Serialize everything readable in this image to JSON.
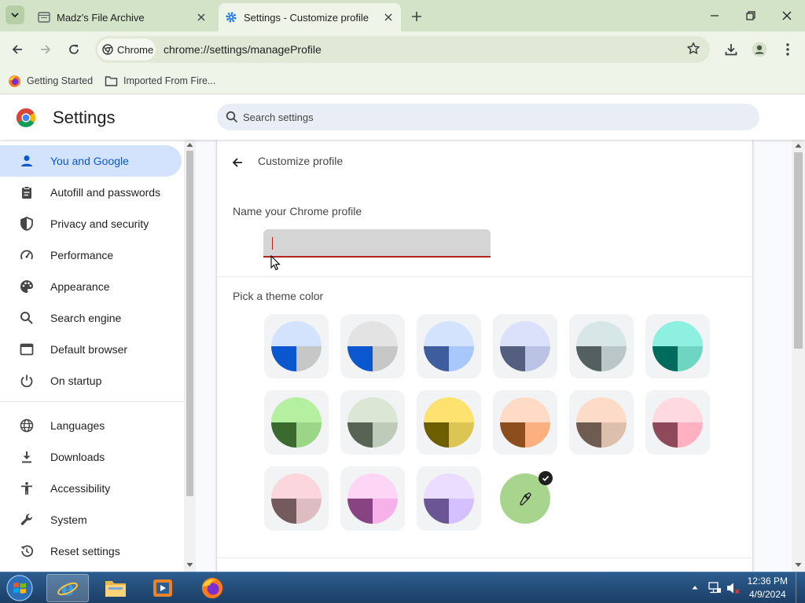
{
  "browser": {
    "tabs": [
      {
        "title": "Madz's File Archive",
        "active": false
      },
      {
        "title": "Settings - Customize profile",
        "active": true
      }
    ],
    "chip_label": "Chrome",
    "url": "chrome://settings/manageProfile",
    "bookmarks": [
      {
        "label": "Getting Started",
        "icon": "firefox-icon"
      },
      {
        "label": "Imported From Fire...",
        "icon": "folder-icon"
      }
    ]
  },
  "settings": {
    "title": "Settings",
    "search_placeholder": "Search settings",
    "nav": [
      {
        "label": "You and Google",
        "icon": "person-icon",
        "selected": true
      },
      {
        "label": "Autofill and passwords",
        "icon": "clipboard-icon"
      },
      {
        "label": "Privacy and security",
        "icon": "shield-icon"
      },
      {
        "label": "Performance",
        "icon": "speedometer-icon"
      },
      {
        "label": "Appearance",
        "icon": "palette-icon"
      },
      {
        "label": "Search engine",
        "icon": "search-icon"
      },
      {
        "label": "Default browser",
        "icon": "browser-window-icon"
      },
      {
        "label": "On startup",
        "icon": "power-icon"
      },
      {
        "label": "Languages",
        "icon": "globe-icon"
      },
      {
        "label": "Downloads",
        "icon": "download-icon"
      },
      {
        "label": "Accessibility",
        "icon": "accessibility-icon"
      },
      {
        "label": "System",
        "icon": "wrench-icon"
      },
      {
        "label": "Reset settings",
        "icon": "reset-history-icon"
      }
    ]
  },
  "page": {
    "title": "Customize profile",
    "name_label": "Name your Chrome profile",
    "name_value": "",
    "theme_label": "Pick a theme color",
    "themes": [
      {
        "top": "#d3e3fd",
        "left": "#0b57d0",
        "right": "#c7c7c7"
      },
      {
        "top": "#e3e3e3",
        "left": "#0b57d0",
        "right": "#c7c7c7"
      },
      {
        "top": "#d3e3fd",
        "left": "#3e5d9f",
        "right": "#a8c7fa"
      },
      {
        "top": "#dbe1fb",
        "left": "#545f7f",
        "right": "#bac3e3"
      },
      {
        "top": "#d7e6e7",
        "left": "#54605f",
        "right": "#b9c7c8"
      },
      {
        "top": "#8ef0e0",
        "left": "#006c5e",
        "right": "#6fd5c3"
      },
      {
        "top": "#b4f0a0",
        "left": "#3b6a2f",
        "right": "#9bd587"
      },
      {
        "top": "#dce6d5",
        "left": "#586356",
        "right": "#bfcbb9"
      },
      {
        "top": "#fde270",
        "left": "#6d5e00",
        "right": "#dcc555"
      },
      {
        "top": "#ffdbc6",
        "left": "#8d4e1d",
        "right": "#fdb07f"
      },
      {
        "top": "#fcdcc9",
        "left": "#6f5b4f",
        "right": "#dcbfad"
      },
      {
        "top": "#ffd9e0",
        "left": "#8e4a5b",
        "right": "#ffb1c1"
      },
      {
        "top": "#fbd7dd",
        "left": "#74595d",
        "right": "#debdc2"
      },
      {
        "top": "#fdd6f6",
        "left": "#884482",
        "right": "#f5b1e8"
      },
      {
        "top": "#ebddff",
        "left": "#6b5594",
        "right": "#d4c0fd"
      }
    ],
    "custom_color": "#a8d58e",
    "selected_theme": "custom"
  },
  "taskbar": {
    "time": "12:36 PM",
    "date": "4/9/2024",
    "apps": [
      "internet-explorer",
      "file-explorer",
      "media-player",
      "firefox"
    ]
  },
  "colors": {
    "accent": "#0b57d0",
    "frame": "#d3e3c7",
    "toolbar": "#eef4e8",
    "error": "#b3261e"
  }
}
